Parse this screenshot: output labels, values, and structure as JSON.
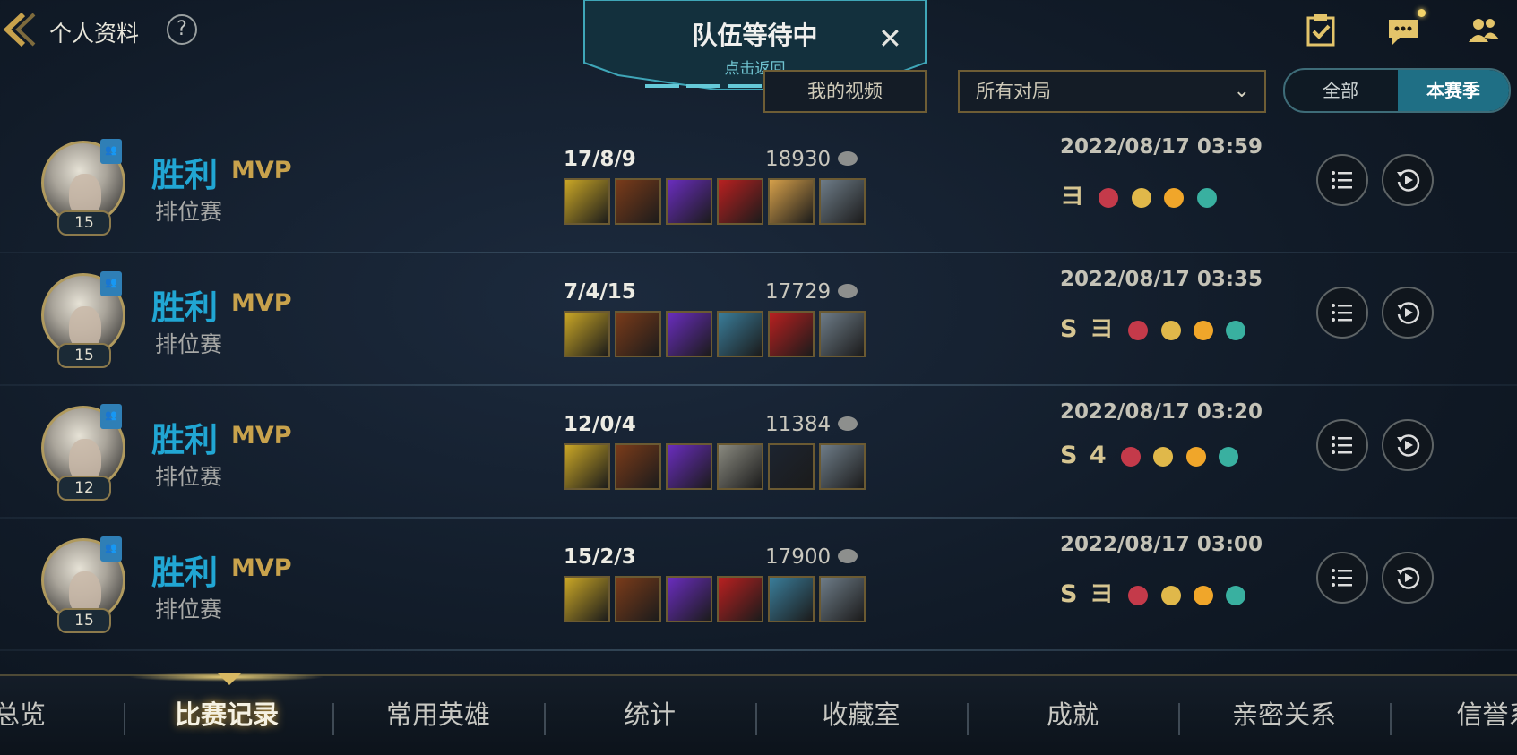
{
  "header": {
    "title": "个人资料",
    "help": "?"
  },
  "queue": {
    "title": "队伍等待中",
    "subtitle": "点击返回",
    "close": "✕"
  },
  "filters": {
    "video_button": "我的视频",
    "match_select": "所有对局",
    "segment_all": "全部",
    "segment_season": "本赛季"
  },
  "matches": [
    {
      "result": "胜利",
      "mvp": "MVP",
      "mode": "排位赛",
      "level": "15",
      "kda": "17/8/9",
      "gold": "18930",
      "datetime": "2022/08/17 03:59",
      "medal_text": "ヨ",
      "items": [
        "#c9a626",
        "#7a3b1a",
        "#6a2dbf",
        "#b82020",
        "#d6a04a",
        "#6e7c88"
      ]
    },
    {
      "result": "胜利",
      "mvp": "MVP",
      "mode": "排位赛",
      "level": "15",
      "kda": "7/4/15",
      "gold": "17729",
      "datetime": "2022/08/17 03:35",
      "medal_text": "S ヨ",
      "items": [
        "#c9a626",
        "#7a3b1a",
        "#6a2dbf",
        "#3a7d9a",
        "#b82020",
        "#6e7c88"
      ]
    },
    {
      "result": "胜利",
      "mvp": "MVP",
      "mode": "排位赛",
      "level": "12",
      "kda": "12/0/4",
      "gold": "11384",
      "datetime": "2022/08/17 03:20",
      "medal_text": "S 4",
      "items": [
        "#c9a626",
        "#7a3b1a",
        "#6a2dbf",
        "#8a8a80",
        "#1c2430",
        "#6e7c88"
      ]
    },
    {
      "result": "胜利",
      "mvp": "MVP",
      "mode": "排位赛",
      "level": "15",
      "kda": "15/2/3",
      "gold": "17900",
      "datetime": "2022/08/17 03:00",
      "medal_text": "S ヨ",
      "items": [
        "#c9a626",
        "#7a3b1a",
        "#6a2dbf",
        "#b82020",
        "#3a7d9a",
        "#6e7c88"
      ]
    }
  ],
  "bottom_tabs": [
    "总览",
    "比赛记录",
    "常用英雄",
    "统计",
    "收藏室",
    "成就",
    "亲密关系",
    "信誉系"
  ],
  "colors": {
    "accent_blue": "#21a6d3",
    "gold": "#c8a24c",
    "active_tab_glow": "#f1d57a"
  }
}
